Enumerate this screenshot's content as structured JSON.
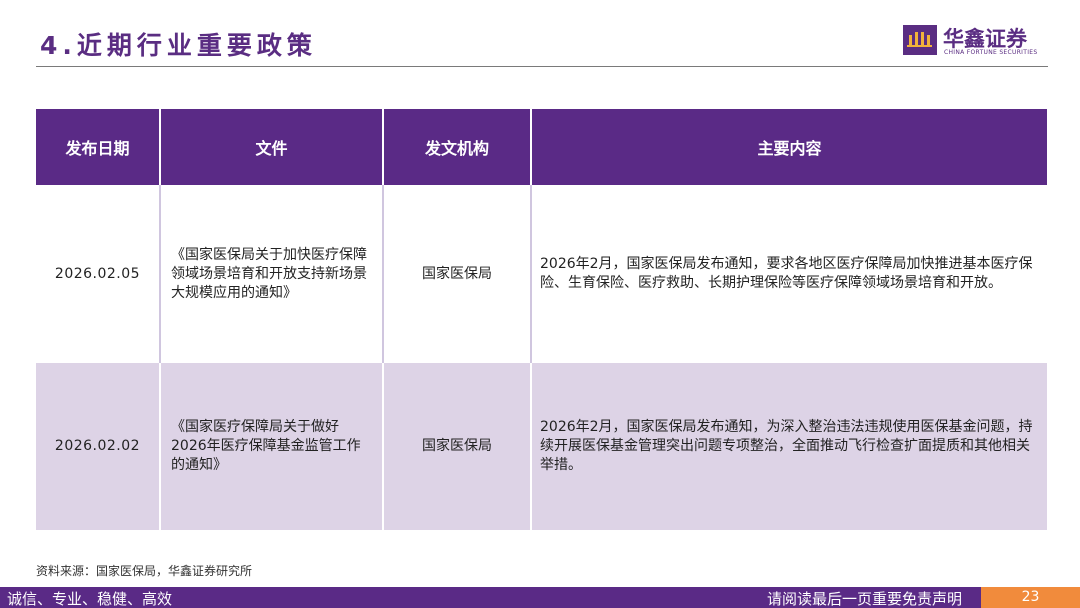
{
  "header": {
    "title": "4.近期行业重要政策",
    "logo_cn": "华鑫证券",
    "logo_en": "CHINA FORTUNE SECURITIES"
  },
  "table": {
    "headers": [
      "发布日期",
      "文件",
      "发文机构",
      "主要内容"
    ],
    "rows": [
      {
        "date": "2026.02.05",
        "document": "《国家医保局关于加快医疗保障领域场景培育和开放支持新场景大规模应用的通知》",
        "agency": "国家医保局",
        "content": "2026年2月，国家医保局发布通知，要求各地区医疗保障局加快推进基本医疗保险、生育保险、医疗救助、长期护理保险等医疗保障领域场景培育和开放。"
      },
      {
        "date": "2026.02.02",
        "document": "《国家医疗保障局关于做好2026年医疗保障基金监管工作的通知》",
        "agency": "国家医保局",
        "content": "2026年2月，国家医保局发布通知，为深入整治违法违规使用医保基金问题，持续开展医保基金管理突出问题专项整治，全面推动飞行检查扩面提质和其他相关举措。"
      }
    ]
  },
  "source": "资料来源：国家医保局，华鑫证券研究所",
  "footer": {
    "slogan": "诚信、专业、稳健、高效",
    "disclaimer": "请阅读最后一页重要免责声明",
    "page": "23"
  },
  "colors": {
    "brand_purple": "#5a2a86",
    "row_shade": "#ddd3e6",
    "page_orange": "#f18b3c"
  }
}
